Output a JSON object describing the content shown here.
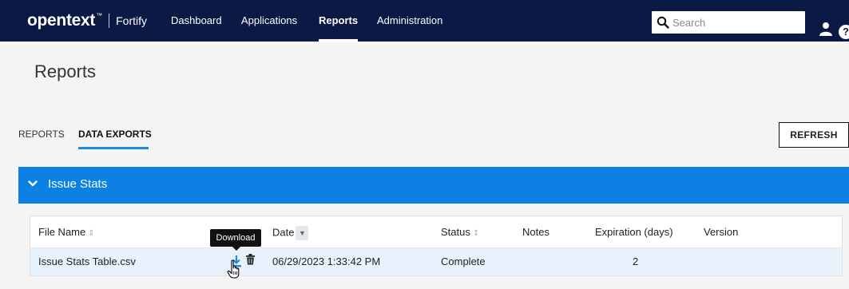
{
  "nav": {
    "brand_main": "opentext",
    "brand_tm": "™",
    "brand_sub": "Fortify",
    "items": [
      {
        "label": "Dashboard",
        "active": false
      },
      {
        "label": "Applications",
        "active": false
      },
      {
        "label": "Reports",
        "active": true
      },
      {
        "label": "Administration",
        "active": false
      }
    ],
    "search": {
      "placeholder": "Search",
      "value": ""
    },
    "icons": [
      "search-icon",
      "user-icon",
      "help-icon"
    ],
    "help_glyph": "?"
  },
  "page": {
    "title": "Reports"
  },
  "tabs": [
    {
      "label": "REPORTS",
      "active": false
    },
    {
      "label": "DATA EXPORTS",
      "active": true
    }
  ],
  "refresh_label": "REFRESH",
  "panel": {
    "title": "Issue Stats",
    "header_color": "#0d80e3",
    "table": {
      "columns": [
        "File Name",
        "Date",
        "Status",
        "Notes",
        "Expiration (days)",
        "Version"
      ],
      "rows": [
        {
          "file_name": "Issue Stats Table.csv",
          "date": "06/29/2023 1:33:42 PM",
          "status": "Complete",
          "notes": "",
          "expiration": "2",
          "version": ""
        }
      ],
      "row_actions": [
        "download-icon",
        "trash-icon"
      ]
    },
    "tooltip": "Download"
  },
  "colors": {
    "nav_bg": "#0b1a45",
    "accent": "#1e88e5",
    "row_highlight": "#e8f2fc"
  }
}
